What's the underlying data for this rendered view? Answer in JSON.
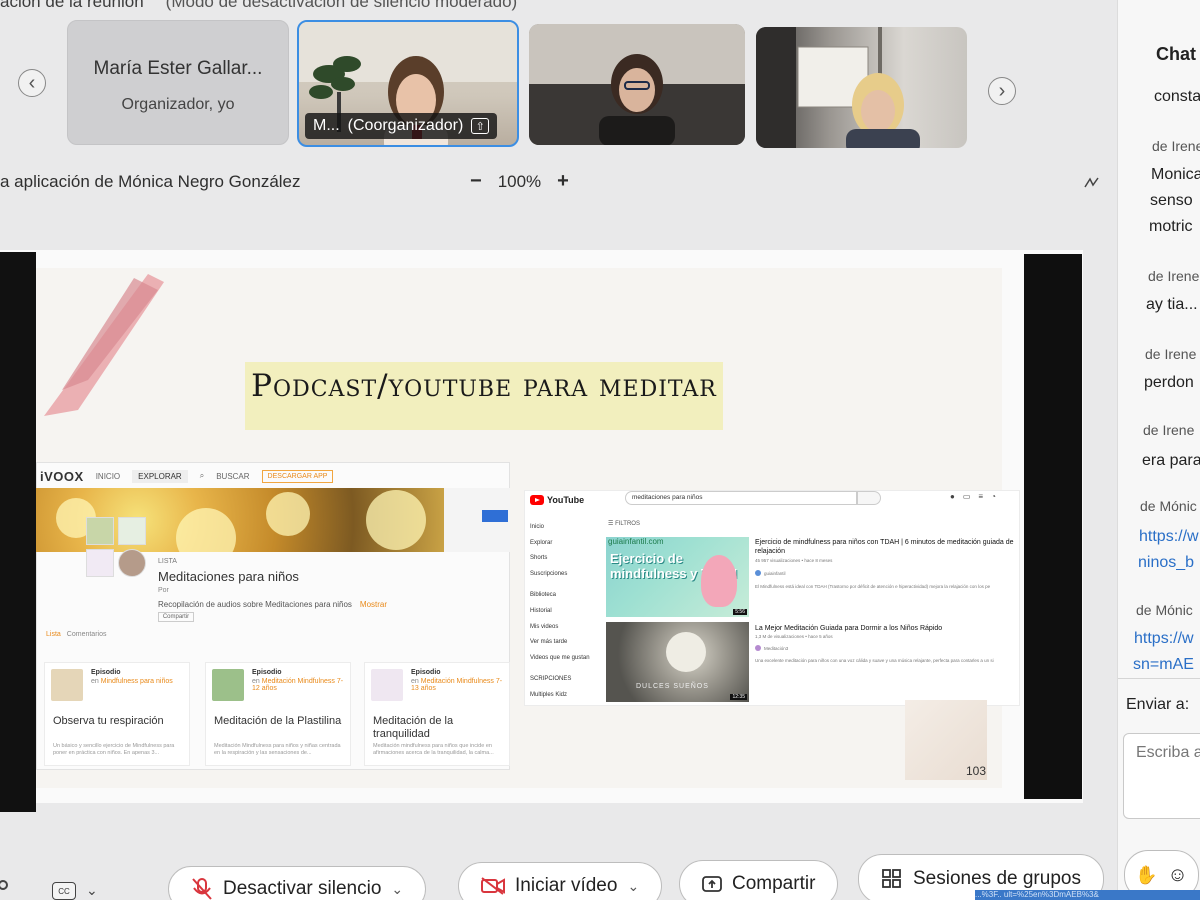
{
  "meeting": {
    "top_text": "ación de la reunión",
    "top_status": "(Modo de desactivación de silencio moderado)",
    "share_title": "a aplicación de Mónica Negro González",
    "zoom": "100%",
    "zoom_minus": "−",
    "zoom_plus": "+"
  },
  "participants": [
    {
      "name": "María Ester Gallar...",
      "role": "Organizador, yo"
    },
    {
      "label_short": "M...",
      "label_role": "(Coorganizador)",
      "share_glyph": "⇧"
    },
    {},
    {}
  ],
  "slide": {
    "title": "Podcast/youtube para meditar",
    "page_number": "103",
    "ivoox": {
      "logo": "iVOOX",
      "nav": [
        "INICIO",
        "EXPLORAR",
        "BUSCAR"
      ],
      "download_btn": "DESCARGAR APP",
      "list_label": "LISTA",
      "list_title": "Meditaciones para niños",
      "by": "Por",
      "description": "Recopilación de audios sobre Meditaciones para niños",
      "show_more": "Mostrar",
      "share": "Compartir",
      "tabs": [
        "Lista",
        "Comentarios"
      ],
      "cards": [
        {
          "type": "Episodio",
          "in": "en",
          "podcast": "Mindfulness para niños",
          "title": "Observa tu respiración",
          "desc": "Un básico y sencillo ejercicio de Mindfulness para poner en práctica con niños. En apenas 3..."
        },
        {
          "type": "Episodio",
          "in": "en",
          "podcast": "Meditación Mindfulness 7-12 años",
          "title": "Meditación de la Plastilina",
          "desc": "Meditación Mindfulness para niños y niñas centrada en la respiración y las sensaciones de..."
        },
        {
          "type": "Episodio",
          "in": "en",
          "podcast": "Meditación Mindfulness 7-13 años",
          "title": "Meditación de la tranquilidad",
          "desc": "Meditación mindfulness para niños que incide en afirmaciones acerca de la tranquilidad, la calma..."
        }
      ]
    },
    "youtube": {
      "logo": "YouTube",
      "search": "meditaciones para niños",
      "sidebar": [
        "Inicio",
        "Explorar",
        "Shorts",
        "Suscripciones",
        "Biblioteca",
        "Historial",
        "Mis videos",
        "Ver más tarde",
        "Videos que me gustan",
        "SCRIPCIONES",
        "Multiples Kidz"
      ],
      "filters": "FILTROS",
      "results": [
        {
          "thumb_site": "guiainfantil.com",
          "thumb_text": "Ejercicio de mindfulness y TDAH",
          "duration": "5:56",
          "title": "Ejercicio de mindfulness para niños con TDAH | 6 minutos de meditación guiada de relajación",
          "meta": "45 957 visualizaciones • hace 8 meses",
          "channel": "guiainfantil",
          "desc": "El Mindfulness está ideal con TDAH (Trastorno por déficit de atención e hiperactividad) mejora la relajación con los pe"
        },
        {
          "thumb_text": "DULCES SUEÑOS",
          "duration": "12:35",
          "title": "La Mejor Meditación Guiada para Dormir a los Niños Rápido",
          "meta": "1,3 M de visualizaciones • hace 5 años",
          "channel": "Meditación3",
          "desc": "Una excelente meditación para niños con una voz cálida y suave y una música relajante, perfecta para contarles a un si"
        }
      ]
    }
  },
  "chat": {
    "title": "Chat",
    "messages": [
      {
        "text": "consta"
      },
      {
        "sender": "de Irene",
        "lines": [
          "Monica",
          "senso",
          "motric"
        ]
      },
      {
        "sender": "de Irene",
        "lines": [
          "ay tia..."
        ]
      },
      {
        "sender": "de Irene",
        "lines": [
          "perdon"
        ]
      },
      {
        "sender": "de Irene",
        "lines": [
          "era para"
        ]
      },
      {
        "sender": "de Mónic",
        "links": [
          "https://w",
          "ninos_b"
        ]
      },
      {
        "sender": "de Mónic",
        "links": [
          "https://w",
          "sn=mAE"
        ]
      }
    ],
    "send_to": "Enviar a:",
    "input_placeholder": "Escriba a"
  },
  "controls": {
    "cc": "CC",
    "mute": "Desactivar silencio",
    "video": "Iniciar vídeo",
    "share": "Compartir",
    "breakout": "Sesiones de grupos",
    "url_snippet": "...%3F.. ult=%25en%3DmAEB%3&"
  },
  "colors": {
    "accent_blue": "#3c8ee3",
    "mute_red": "#d9363e",
    "ivoox_orange": "#e98a1a",
    "youtube_red": "#ff0000"
  }
}
